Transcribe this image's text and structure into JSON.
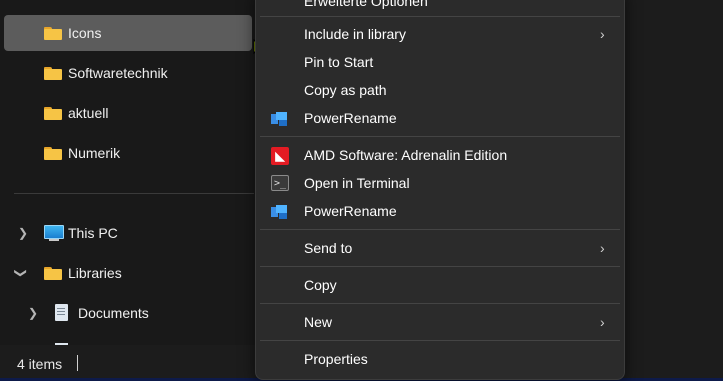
{
  "nav": {
    "folders": [
      {
        "label": "Icons",
        "selected": true
      },
      {
        "label": "Softwaretechnik",
        "selected": false
      },
      {
        "label": "aktuell",
        "selected": false
      },
      {
        "label": "Numerik",
        "selected": false
      }
    ],
    "this_pc": "This PC",
    "libraries": "Libraries",
    "documents": "Documents"
  },
  "status": {
    "items": "4 items"
  },
  "menu": {
    "top_partial": "Erweiterte Optionen",
    "include_in_library": "Include in library",
    "pin_to_start": "Pin to Start",
    "copy_as_path": "Copy as path",
    "powerrename_1": "PowerRename",
    "amd": "AMD Software: Adrenalin Edition",
    "open_in_terminal": "Open in Terminal",
    "powerrename_2": "PowerRename",
    "send_to": "Send to",
    "copy": "Copy",
    "new": "New",
    "properties": "Properties"
  },
  "colors": {
    "background": "#1c1c1c",
    "menu_bg": "#2b2b2b",
    "selected": "#5c5c5c",
    "folder": "#f6c445",
    "amd_red": "#e31b23"
  }
}
